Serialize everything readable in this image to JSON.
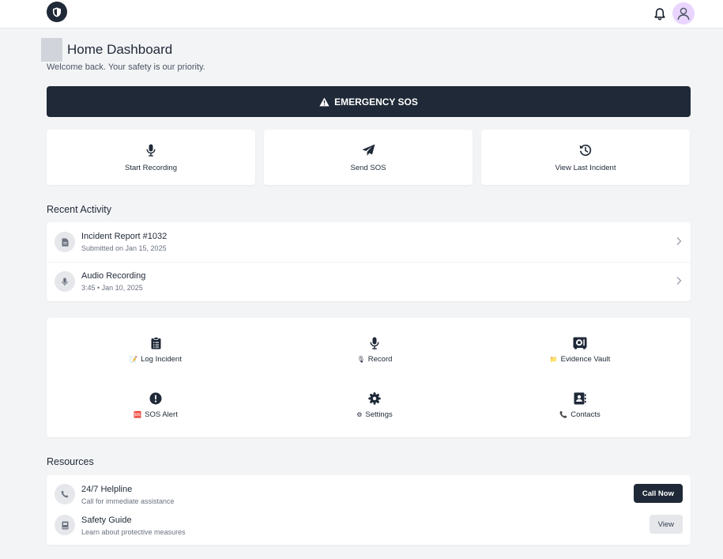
{
  "header": {
    "logo_icon": "shield-icon",
    "notification_icon": "bell-icon",
    "avatar_icon": "user-icon"
  },
  "page": {
    "title": "Home Dashboard",
    "subtitle": "Welcome back. Your safety is our priority."
  },
  "emergency": {
    "label": "EMERGENCY SOS",
    "icon": "warning-icon"
  },
  "quick_actions": [
    {
      "label": "Start Recording",
      "icon": "microphone-icon"
    },
    {
      "label": "Send SOS",
      "icon": "paper-plane-icon"
    },
    {
      "label": "View Last Incident",
      "icon": "history-icon"
    }
  ],
  "recent_activity": {
    "heading": "Recent Activity",
    "items": [
      {
        "title": "Incident Report #1032",
        "subtitle": "Submitted on Jan 15, 2025",
        "icon": "file-icon"
      },
      {
        "title": "Audio Recording",
        "subtitle": "3:45 • Jan 10, 2025",
        "icon": "microphone-icon"
      }
    ]
  },
  "features": [
    {
      "label": "Log Incident",
      "emoji": "📝",
      "icon": "clipboard-list-icon"
    },
    {
      "label": "Record",
      "emoji": "🎙",
      "icon": "microphone-icon"
    },
    {
      "label": "Evidence Vault",
      "emoji": "📁",
      "icon": "vault-icon"
    },
    {
      "label": "SOS Alert",
      "emoji": "🆘",
      "icon": "exclamation-circle-icon"
    },
    {
      "label": "Settings",
      "emoji": "⚙",
      "icon": "gear-icon"
    },
    {
      "label": "Contacts",
      "emoji": "📞",
      "icon": "address-book-icon"
    }
  ],
  "resources": {
    "heading": "Resources",
    "items": [
      {
        "title": "24/7 Helpline",
        "subtitle": "Call for immediate assistance",
        "button": "Call Now",
        "icon": "phone-icon"
      },
      {
        "title": "Safety Guide",
        "subtitle": "Learn about protective measures",
        "button": "View",
        "icon": "book-icon"
      }
    ]
  },
  "colors": {
    "primary": "#1f2937",
    "background": "#f3f4f6",
    "avatar_bg": "#e9d5ff"
  }
}
